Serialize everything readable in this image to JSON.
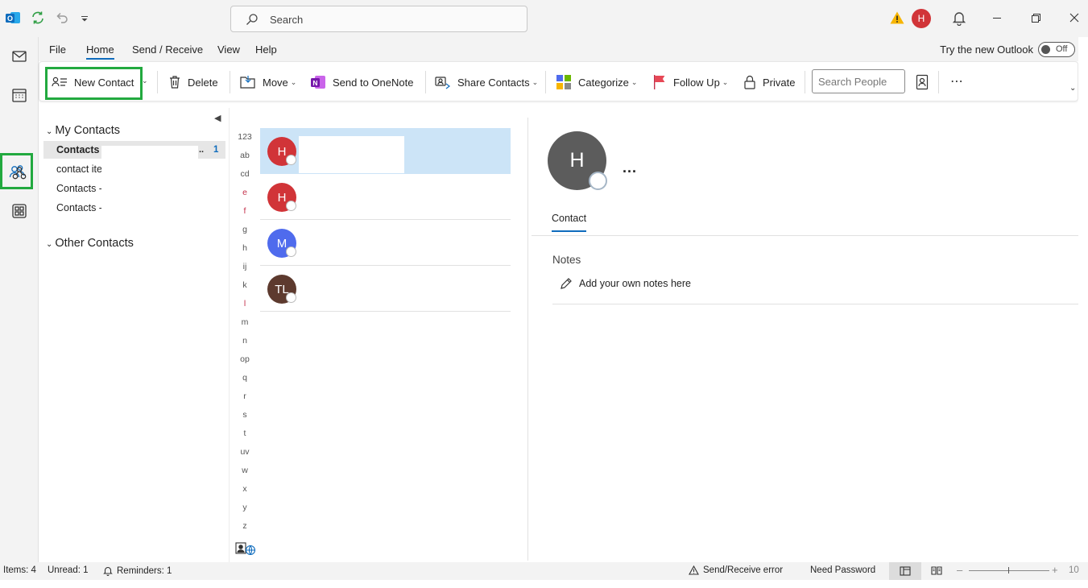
{
  "titlebar": {
    "search_placeholder": "Search",
    "profile_initial": "H"
  },
  "menu": {
    "tabs": [
      "File",
      "Home",
      "Send / Receive",
      "View",
      "Help"
    ],
    "active_tab": "Home",
    "try_new_outlook": "Try the new Outlook",
    "toggle_label": "Off"
  },
  "ribbon": {
    "new_contact": "New Contact",
    "delete": "Delete",
    "move": "Move",
    "send_to_onenote": "Send to OneNote",
    "share_contacts": "Share Contacts",
    "categorize": "Categorize",
    "follow_up": "Follow Up",
    "private": "Private",
    "search_people_placeholder": "Search People"
  },
  "folders": {
    "my_contacts_header": "My Contacts",
    "items": [
      {
        "label": "Contacts -",
        "count": "1",
        "selected": true
      },
      {
        "label": "contact ite",
        "count": "",
        "selected": false
      },
      {
        "label": "Contacts -",
        "count": "",
        "selected": false
      },
      {
        "label": "Contacts -",
        "count": "",
        "selected": false
      }
    ],
    "other_contacts_header": "Other Contacts"
  },
  "alphabet": [
    "123",
    "ab",
    "cd",
    "e",
    "f",
    "g",
    "h",
    "ij",
    "k",
    "l",
    "m",
    "n",
    "op",
    "q",
    "r",
    "s",
    "t",
    "uv",
    "w",
    "x",
    "y",
    "z"
  ],
  "contacts": [
    {
      "initials": "H",
      "color": "#d13438",
      "selected": true
    },
    {
      "initials": "H",
      "color": "#d13438",
      "selected": false
    },
    {
      "initials": "M",
      "color": "#4f6bed",
      "selected": false
    },
    {
      "initials": "TL",
      "color": "#5d3a2e",
      "selected": false
    }
  ],
  "reading": {
    "initial": "H",
    "more": "...",
    "tab_contact": "Contact",
    "notes_label": "Notes",
    "notes_placeholder": "Add your own notes here"
  },
  "status": {
    "items": "Items: 4",
    "unread": "Unread: 1",
    "reminders": "Reminders: 1",
    "send_receive_error": "Send/Receive error",
    "need_password": "Need Password",
    "zoom": "10"
  },
  "colors": {
    "accent": "#0f6cbd",
    "highlight": "#22a93f",
    "selection": "#cce4f7"
  }
}
